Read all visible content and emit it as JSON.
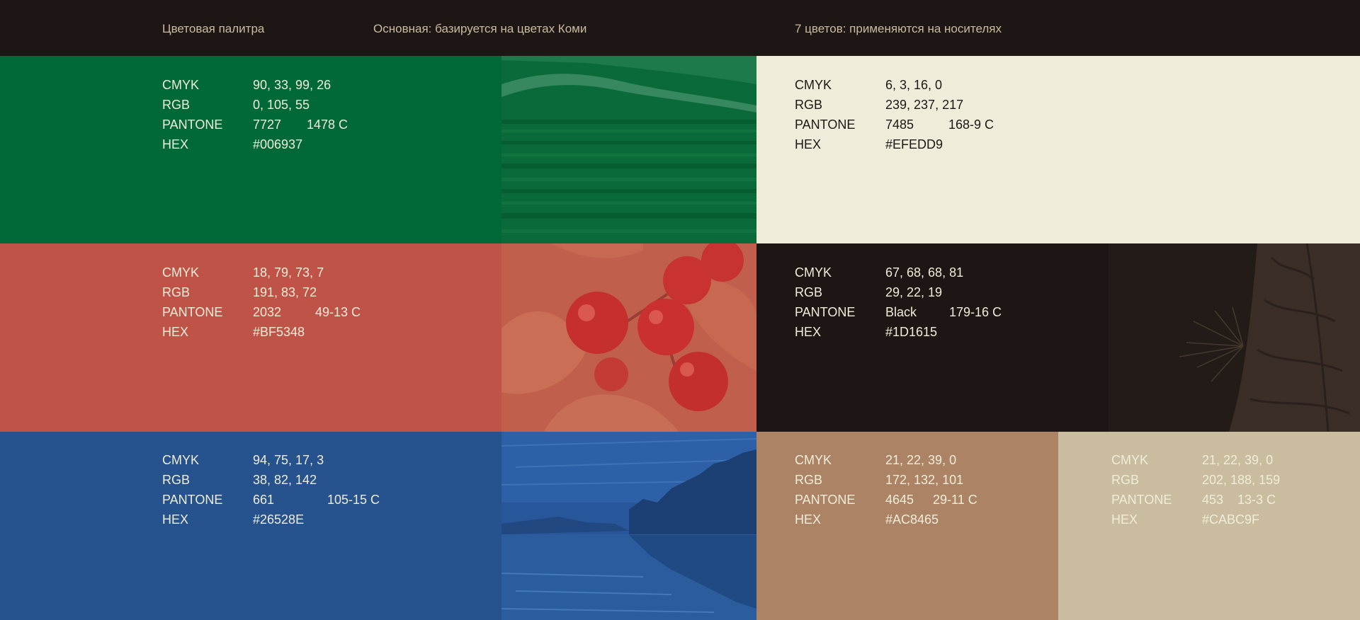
{
  "header": {
    "palette_title": "Цветовая палитра",
    "main_caption": "Основная: базируется на цветах Коми",
    "secondary_caption": "7 цветов: применяются на носителях"
  },
  "labels": {
    "cmyk": "CMYK",
    "rgb": "RGB",
    "pantone": "PANTONE",
    "hex": "HEX"
  },
  "swatches": {
    "green": {
      "cmyk": "90, 33, 99, 26",
      "rgb": "0, 105, 55",
      "pantone1": "7727",
      "pantone2": "1478 C",
      "hex": "#006937",
      "color": "#006937"
    },
    "cream": {
      "cmyk": "6, 3, 16, 0",
      "rgb": "239, 237, 217",
      "pantone1": "7485",
      "pantone2": "168-9 C",
      "hex": "#EFEDD9",
      "color": "#EFEDD9"
    },
    "red": {
      "cmyk": "18, 79, 73, 7",
      "rgb": "191, 83, 72",
      "pantone1": "2032",
      "pantone2": "49-13 C",
      "hex": "#BF5348",
      "color": "#BF5348"
    },
    "black": {
      "cmyk": "67, 68, 68, 81",
      "rgb": "29, 22, 19",
      "pantone1": "Black",
      "pantone2": "179-16 C",
      "hex": "#1D1615",
      "color": "#1D1615"
    },
    "blue": {
      "cmyk": "94, 75, 17, 3",
      "rgb": "38, 82, 142",
      "pantone1": "661",
      "pantone2": "105-15 C",
      "hex": "#26528E",
      "color": "#26528E"
    },
    "brown": {
      "cmyk": "21, 22, 39, 0",
      "rgb": "172, 132, 101",
      "pantone1": "4645",
      "pantone2": "29-11 C",
      "hex": "#AC8465",
      "color": "#AC8465"
    },
    "beige": {
      "cmyk": "21, 22, 39, 0",
      "rgb": "202, 188, 159",
      "pantone1": "453",
      "pantone2": "13-3 C",
      "hex": "#CABC9F",
      "color": "#CABC9F"
    }
  },
  "photos": {
    "forest": "forest-river-photo",
    "berries": "lingonberry-photo",
    "lake": "forest-lake-photo",
    "bark": "pine-bark-photo"
  }
}
